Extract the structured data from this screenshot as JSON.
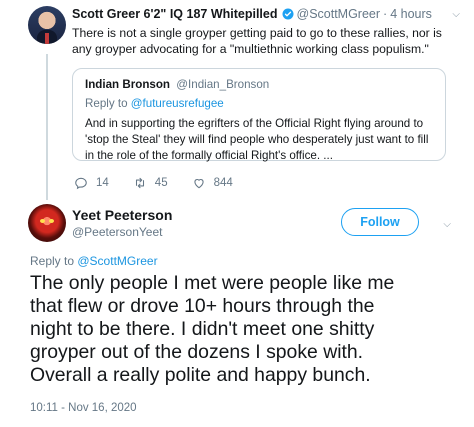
{
  "parent": {
    "name": "Scott Greer 6'2\" IQ 187 Whitepilled",
    "handle": "@ScottMGreer",
    "time": "4 hours",
    "text": "There is not a single groyper getting paid to go to these rallies, nor is any groyper advocating for a \"multiethnic working class populism.\"",
    "quote": {
      "name": "Indian Bronson",
      "handle": "@Indian_Bronson",
      "reply_prefix": "Reply to",
      "reply_to": "@futureusrefugee",
      "text": "And in supporting the egrifters of the Official Right flying around to 'stop the Steal' they will find people who desperately just want to fill in the role of the formally official Right's office. ..."
    },
    "actions": {
      "replies": "14",
      "retweets": "45",
      "likes": "844"
    }
  },
  "main": {
    "name": "Yeet Peeterson",
    "handle": "@PeetersonYeet",
    "follow_label": "Follow",
    "reply_prefix": "Reply to",
    "reply_to": "@ScottMGreer",
    "text_lines": [
      "The only people I met were people like me",
      "that flew or drove 10+ hours through the",
      "night to be there. I didn't meet one shitty",
      "groyper out of the dozens I spoke with.",
      "Overall a really polite and happy bunch."
    ],
    "timestamp": "10:11 - Nov 16, 2020"
  },
  "colors": {
    "accent": "#1da1f2",
    "muted": "#657786",
    "border": "#ccd6dd"
  }
}
